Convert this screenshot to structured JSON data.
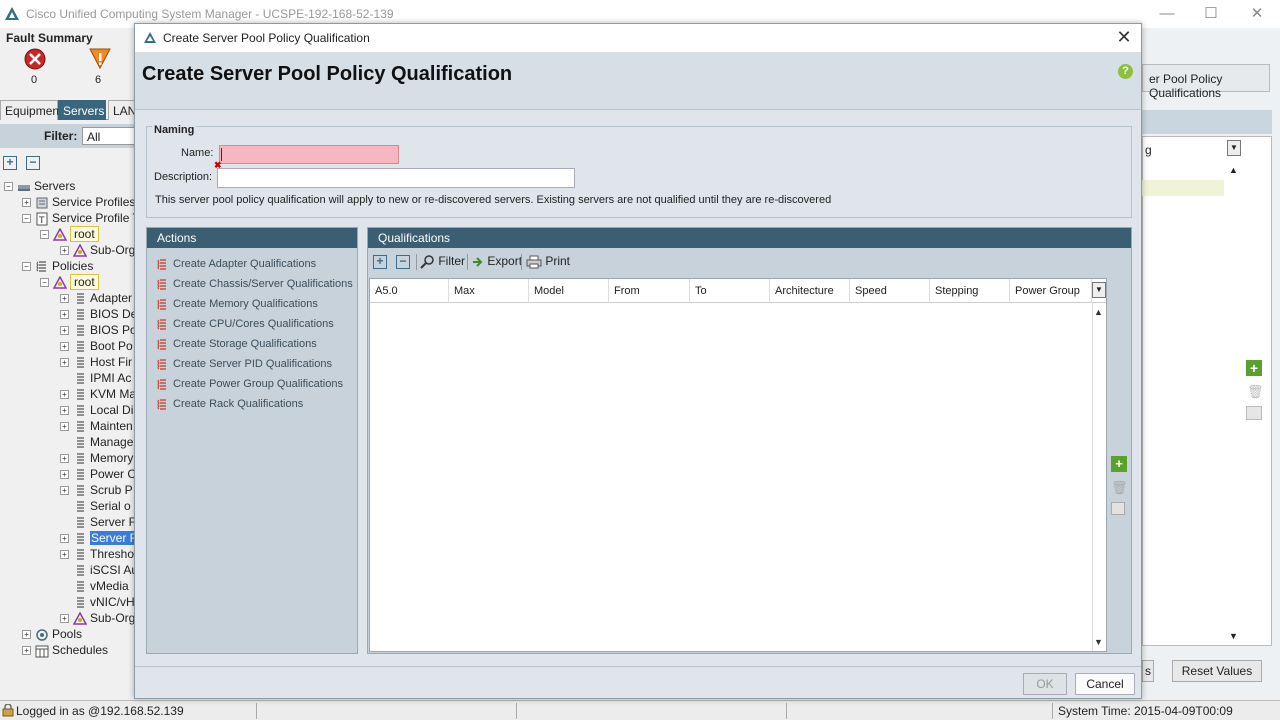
{
  "app": {
    "title": "Cisco Unified Computing System Manager - UCSPE-192-168-52-139"
  },
  "fault_summary": {
    "title": "Fault Summary",
    "critical_count": "0",
    "major_count": "6"
  },
  "nav": {
    "tabs": [
      "Equipment",
      "Servers",
      "LAN"
    ],
    "filter_label": "Filter:",
    "filter_value": "All"
  },
  "tree": {
    "items": [
      "Servers",
      "Service Profiles",
      "Service Profile T",
      "root",
      "Sub-Org",
      "Policies",
      "root",
      "Adapter",
      "BIOS De",
      "BIOS Po",
      "Boot Po",
      "Host Fir",
      "IPMI Ac",
      "KVM Ma",
      "Local Di",
      "Mainten",
      "Manage",
      "Memory",
      "Power C",
      "Scrub P",
      "Serial o",
      "Server F",
      "Server F",
      "Thresho",
      "iSCSI Au",
      "vMedia",
      "vNIC/vH",
      "Sub-Org",
      "Pools",
      "Schedules"
    ]
  },
  "right_pane": {
    "tab_label": "er Pool Policy Qualifications",
    "col_fragment": "g",
    "btn_partial": "s",
    "btn_reset": "Reset Values"
  },
  "status": {
    "login": "Logged in as      @192.168.52.139",
    "time": "System Time: 2015-04-09T00:09"
  },
  "dialog": {
    "window_title": "Create Server Pool Policy Qualification",
    "header": "Create Server Pool Policy Qualification",
    "naming": {
      "legend": "Naming",
      "name_label": "Name:",
      "name_value": "",
      "desc_label": "Description:",
      "desc_value": "",
      "note": "This server pool policy qualification will apply to new or re-discovered servers. Existing servers are not qualified until they are re-discovered"
    },
    "actions": {
      "title": "Actions",
      "items": [
        "Create Adapter Qualifications",
        "Create Chassis/Server Qualifications",
        "Create Memory Qualifications",
        "Create CPU/Cores Qualifications",
        "Create Storage Qualifications",
        "Create Server PID Qualifications",
        "Create Power Group Qualifications",
        "Create Rack Qualifications"
      ]
    },
    "qualifications": {
      "title": "Qualifications",
      "toolbar": {
        "filter": "Filter",
        "export": "Export",
        "print": "Print"
      },
      "columns": [
        "A5.0",
        "Max",
        "Model",
        "From",
        "To",
        "Architecture",
        "Speed",
        "Stepping",
        "Power Group"
      ],
      "rows": []
    },
    "footer": {
      "ok": "OK",
      "cancel": "Cancel"
    }
  },
  "colors": {
    "panel_header": "#3b5e73",
    "selection": "#3a7dd6",
    "error_field": "#f6b7c1",
    "add_green": "#5aa02c"
  }
}
